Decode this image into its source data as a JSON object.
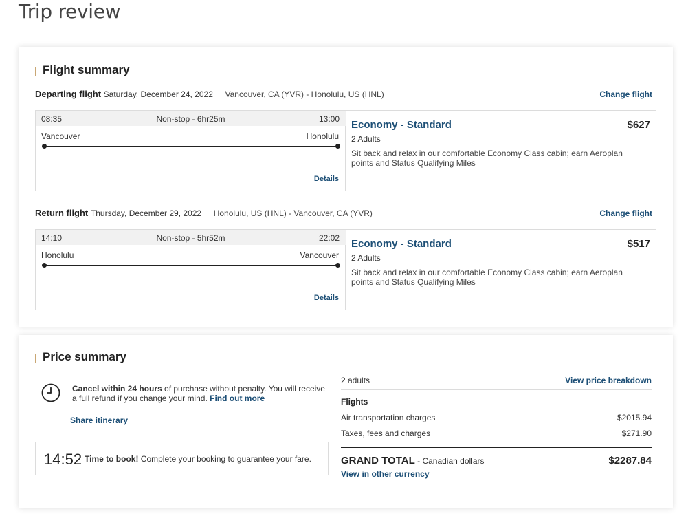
{
  "page": {
    "title": "Trip review"
  },
  "flight_summary": {
    "heading": "Flight summary",
    "flights": [
      {
        "label": "Departing flight",
        "date": "Saturday, December 24, 2022",
        "route": "Vancouver, CA (YVR) - Honolulu, US (HNL)",
        "change_label": "Change flight",
        "dep_time": "08:35",
        "duration": "Non-stop - 6hr25m",
        "arr_time": "13:00",
        "from_city": "Vancouver",
        "to_city": "Honolulu",
        "details_label": "Details",
        "fare_name": "Economy - Standard",
        "price": "$627",
        "passengers": "2 Adults",
        "description": "Sit back and relax in our comfortable Economy Class cabin; earn Aeroplan points and Status Qualifying Miles"
      },
      {
        "label": "Return flight",
        "date": "Thursday, December 29, 2022",
        "route": "Honolulu, US (HNL) - Vancouver, CA (YVR)",
        "change_label": "Change flight",
        "dep_time": "14:10",
        "duration": "Non-stop - 5hr52m",
        "arr_time": "22:02",
        "from_city": "Honolulu",
        "to_city": "Vancouver",
        "details_label": "Details",
        "fare_name": "Economy - Standard",
        "price": "$517",
        "passengers": "2 Adults",
        "description": "Sit back and relax in our comfortable Economy Class cabin; earn Aeroplan points and Status Qualifying Miles"
      }
    ]
  },
  "price_summary": {
    "heading": "Price summary",
    "cancel": {
      "bold": "Cancel within 24 hours",
      "text": " of purchase without penalty. You will receive a full refund if you change your mind. ",
      "link": "Find out more"
    },
    "share_label": "Share itinerary",
    "timer": {
      "value": "14:52",
      "bold": "Time to book!",
      "text": " Complete your booking to guarantee your fare."
    },
    "passengers": "2 adults",
    "breakdown_label": "View price breakdown",
    "flights_label": "Flights",
    "air_label": "Air transportation charges",
    "air_value": "$2015.94",
    "tax_label": "Taxes, fees and charges",
    "tax_value": "$271.90",
    "total_label": "GRAND TOTAL",
    "total_currency": " - Canadian dollars",
    "total_value": "$2287.84",
    "other_currency_label": "View in other currency"
  },
  "colors": {
    "link": "#1d4f76",
    "accent_bar": "#c9a774"
  },
  "icons": {
    "clock": "clock-icon"
  }
}
